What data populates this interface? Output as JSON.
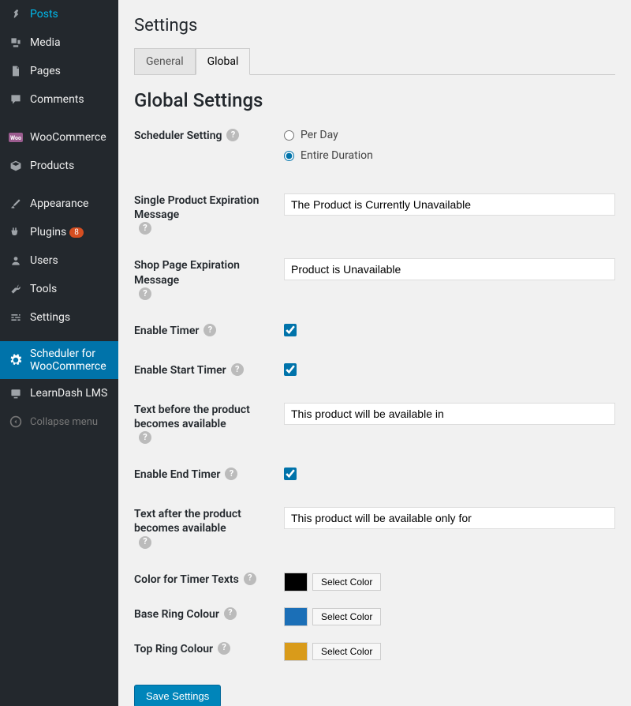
{
  "sidebar": {
    "items": [
      {
        "label": "Posts",
        "icon": "pin"
      },
      {
        "label": "Media",
        "icon": "media"
      },
      {
        "label": "Pages",
        "icon": "page"
      },
      {
        "label": "Comments",
        "icon": "comment"
      }
    ],
    "items2": [
      {
        "label": "WooCommerce",
        "icon": "woo"
      },
      {
        "label": "Products",
        "icon": "box"
      }
    ],
    "items3": [
      {
        "label": "Appearance",
        "icon": "brush"
      },
      {
        "label": "Plugins",
        "icon": "plug",
        "badge": "8"
      },
      {
        "label": "Users",
        "icon": "user"
      },
      {
        "label": "Tools",
        "icon": "wrench"
      },
      {
        "label": "Settings",
        "icon": "sliders"
      }
    ],
    "items4": [
      {
        "label": "Scheduler for WooCommerce",
        "icon": "gear",
        "current": true
      },
      {
        "label": "LearnDash LMS",
        "icon": "ld"
      }
    ],
    "collapse": "Collapse menu"
  },
  "page": {
    "title": "Settings",
    "tabs": {
      "general": "General",
      "global": "Global"
    },
    "heading": "Global Settings"
  },
  "form": {
    "scheduler_label": "Scheduler Setting",
    "radio_per_day": "Per Day",
    "radio_entire": "Entire Duration",
    "single_exp_label": "Single Product Expiration Message",
    "single_exp_value": "The Product is Currently Unavailable",
    "shop_exp_label": "Shop Page Expiration Message",
    "shop_exp_value": "Product is Unavailable",
    "enable_timer_label": "Enable Timer",
    "enable_start_label": "Enable Start Timer",
    "text_before_label": "Text before the product becomes available",
    "text_before_value": "This product will be available in",
    "enable_end_label": "Enable End Timer",
    "text_after_label": "Text after the product becomes available",
    "text_after_value": "This product will be available only for",
    "color_timer_label": "Color for Timer Texts",
    "base_ring_label": "Base Ring Colour",
    "top_ring_label": "Top Ring Colour",
    "select_color": "Select Color",
    "colors": {
      "timer": "#000000",
      "base": "#1b6fb7",
      "top": "#d99b1a"
    },
    "save": "Save Settings"
  }
}
